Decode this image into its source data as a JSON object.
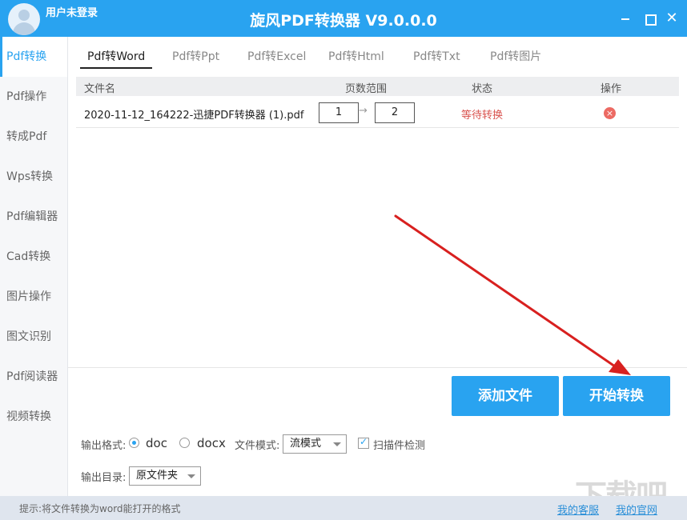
{
  "titlebar": {
    "username": "用户未登录",
    "app_title": "旋风PDF转换器 V9.0.0.0",
    "close_glyph": "✕"
  },
  "sidebar": {
    "items": [
      {
        "label": "Pdf转换",
        "active": true
      },
      {
        "label": "Pdf操作"
      },
      {
        "label": "转成Pdf"
      },
      {
        "label": "Wps转换"
      },
      {
        "label": "Pdf编辑器"
      },
      {
        "label": "Cad转换"
      },
      {
        "label": "图片操作"
      },
      {
        "label": "图文识别"
      },
      {
        "label": "Pdf阅读器"
      },
      {
        "label": "视频转换"
      }
    ]
  },
  "tabs": [
    {
      "label": "Pdf转Word",
      "active": true
    },
    {
      "label": "Pdf转Ppt"
    },
    {
      "label": "Pdf转Excel"
    },
    {
      "label": "Pdf转Html"
    },
    {
      "label": "Pdf转Txt"
    },
    {
      "label": "Pdf转图片"
    }
  ],
  "table": {
    "headers": {
      "filename": "文件名",
      "page_range": "页数范围",
      "status": "状态",
      "action": "操作"
    },
    "rows": [
      {
        "filename": "2020-11-12_164222-迅捷PDF转换器 (1).pdf",
        "page_from": "1",
        "page_to": "2",
        "status": "等待转换"
      }
    ],
    "arrow_glyph": "→",
    "delete_glyph": "×"
  },
  "buttons": {
    "add_file": "添加文件",
    "start_convert": "开始转换"
  },
  "options": {
    "output_format_label": "输出格式:",
    "format_doc": "doc",
    "format_docx": "docx",
    "selected_format": "doc",
    "file_mode_label": "文件模式:",
    "file_mode_value": "流模式",
    "scan_check_label": "扫描件检测",
    "scan_check_checked": true,
    "output_dir_label": "输出目录:",
    "output_dir_value": "原文件夹"
  },
  "statusbar": {
    "hint": "提示:将文件转换为word能打开的格式",
    "support_link": "我的客服",
    "website_link": "我的官网"
  },
  "watermark": "下载吧",
  "colors": {
    "accent": "#29a3f0",
    "status_waiting": "#d9534f",
    "annotation_arrow": "#d8201f"
  }
}
